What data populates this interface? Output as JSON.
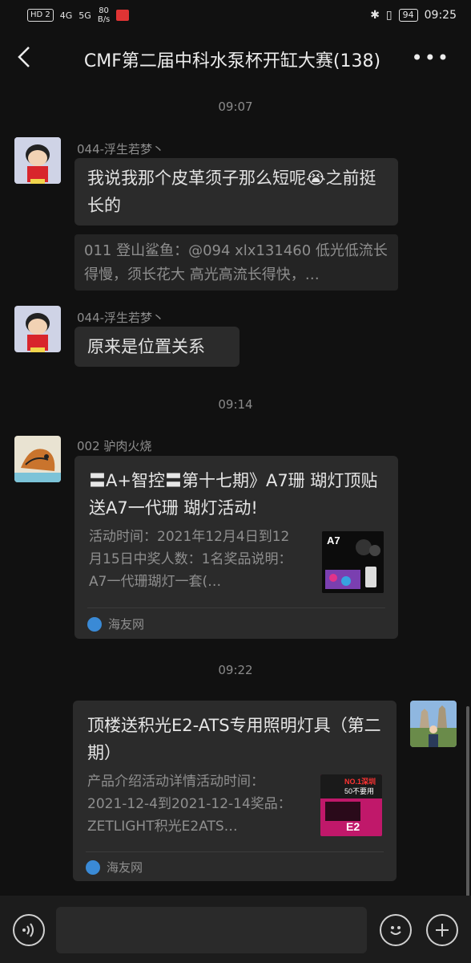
{
  "status": {
    "hd": "HD 2",
    "sig1": "4G",
    "sig2": "5G",
    "speed": "80\nB/s",
    "battery": "94",
    "clock": "09:25"
  },
  "header": {
    "title": "CMF第二届中科水泵杯开缸大赛(138)",
    "more": "•••"
  },
  "messages": {
    "t1": "09:07",
    "m1_name": "044-浮生若梦丶",
    "m1_text": "我说我那个皮革须子那么短呢😭之前挺长的",
    "m1_quote": "011 登山鲨鱼：@094 xlx131460 低光低流长得慢，须长花大 高光高流长得快，…",
    "m2_name": "044-浮生若梦丶",
    "m2_text": "原来是位置关系",
    "t2": "09:14",
    "m3_name": "002 驴肉火烧",
    "card1_title": "〓A+智控〓第十七期》A7珊 瑚灯顶贴送A7一代珊 瑚灯活动!",
    "card1_desc": "活动时间：2021年12月4日到12月15日中奖人数：1名奖品说明：A7一代珊瑚灯一套(…",
    "card1_source": "海友网",
    "card1_thumb_text": "A7",
    "t3": "09:22",
    "card2_title": "顶楼送积光E2-ATS专用照明灯具（第二期）",
    "card2_desc": "产品介绍活动详情活动时间：2021-12-4到2021-12-14奖品：ZETLIGHT积光E2ATS…",
    "card2_source": "海友网",
    "card2_thumb_line1": "NO.1深圳",
    "card2_thumb_line2": "50不要用",
    "card2_thumb_e2": "E2"
  },
  "colors": {
    "background": "#111111",
    "bubble": "#2b2b2b",
    "accent_red": "#e03434"
  }
}
